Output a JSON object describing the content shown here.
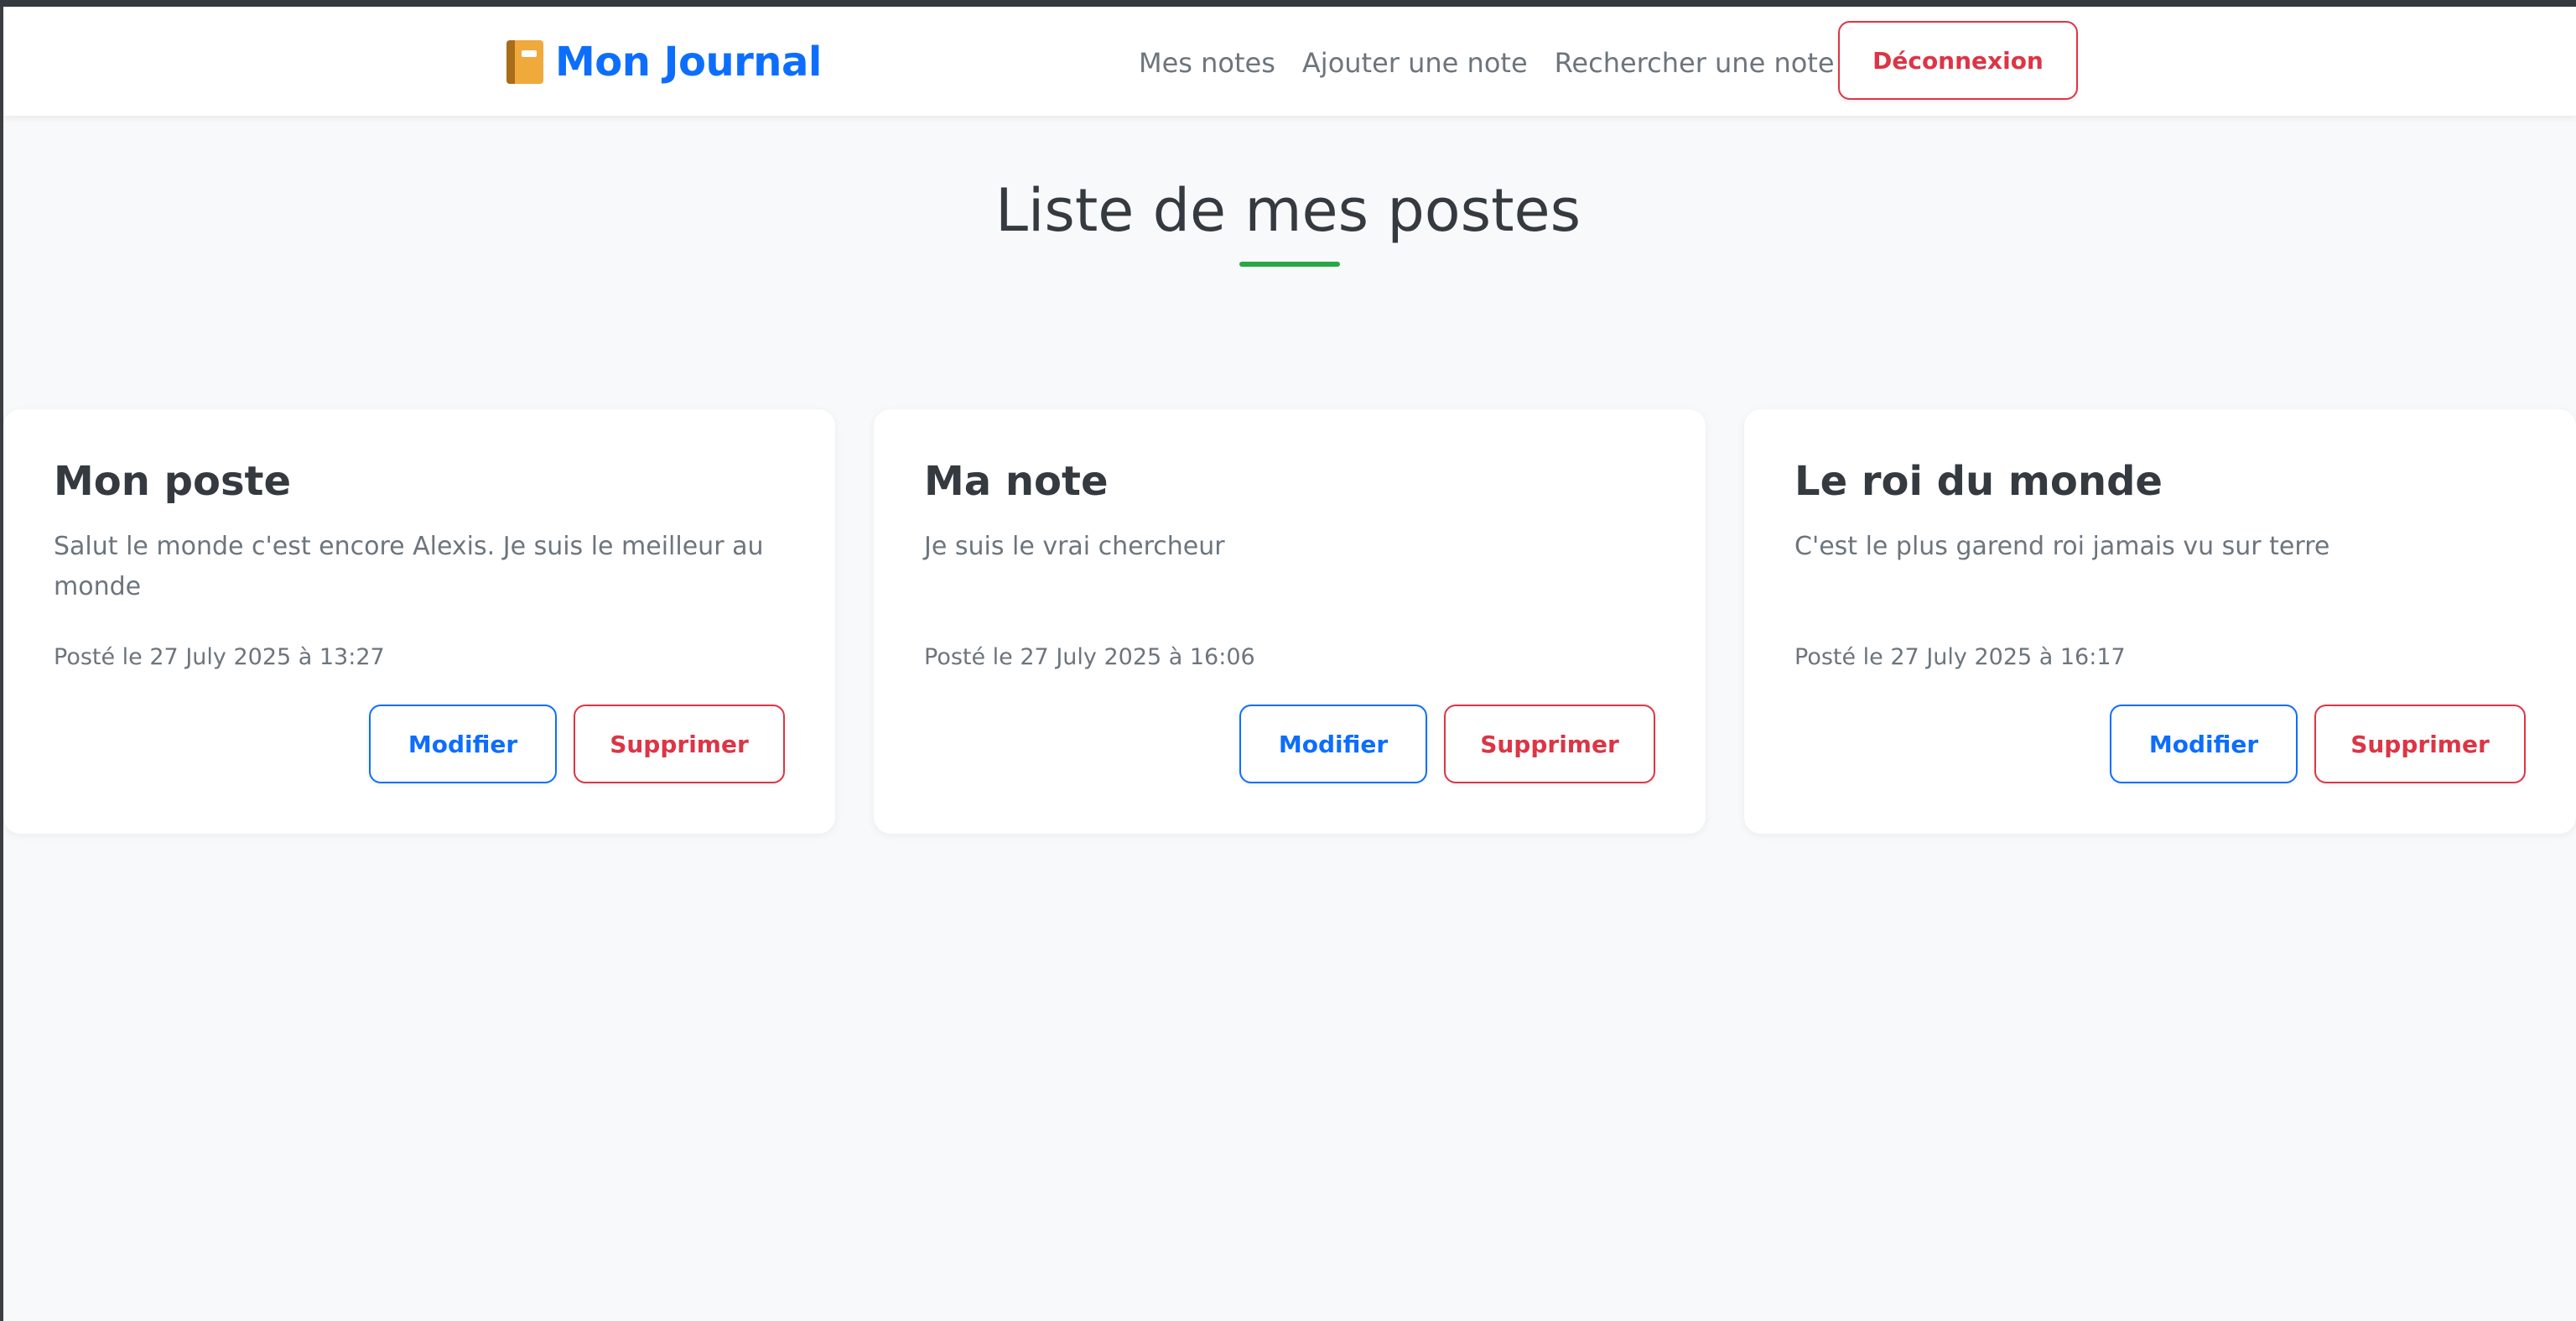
{
  "brand": {
    "icon": "notebook-icon",
    "name": "Mon Journal"
  },
  "nav": {
    "links": [
      "Mes notes",
      "Ajouter une note",
      "Rechercher une note"
    ],
    "logout_label": "Déconnexion"
  },
  "page": {
    "title": "Liste de mes postes"
  },
  "posts": [
    {
      "title": "Mon poste",
      "body": "Salut le monde c'est encore Alexis. Je suis le meilleur au monde",
      "date": "Posté le 27 July 2025 à 13:27",
      "edit_label": "Modifier",
      "delete_label": "Supprimer"
    },
    {
      "title": "Ma note",
      "body": "Je suis le vrai chercheur",
      "date": "Posté le 27 July 2025 à 16:06",
      "edit_label": "Modifier",
      "delete_label": "Supprimer"
    },
    {
      "title": "Le roi du monde",
      "body": "C'est le plus garend roi jamais vu sur terre",
      "date": "Posté le 27 July 2025 à 16:17",
      "edit_label": "Modifier",
      "delete_label": "Supprimer"
    }
  ],
  "colors": {
    "primary": "#0d6efd",
    "danger": "#dc3545",
    "accent": "#28a745",
    "text": "#343a40",
    "muted": "#6c757d",
    "background": "#f8f9fa"
  }
}
